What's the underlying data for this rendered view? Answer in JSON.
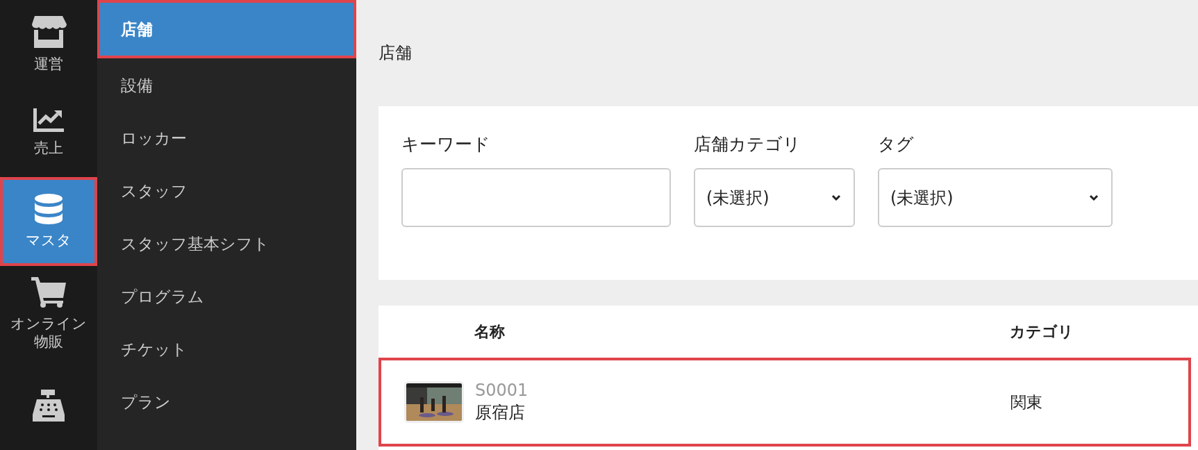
{
  "rail": [
    {
      "label": "運営",
      "selected": false,
      "highlighted": false
    },
    {
      "label": "売上",
      "selected": false,
      "highlighted": false
    },
    {
      "label": "マスタ",
      "selected": true,
      "highlighted": true
    },
    {
      "label": "オンライン物販",
      "selected": false,
      "highlighted": false
    },
    {
      "selected": false,
      "highlighted": false
    }
  ],
  "sidebar": {
    "items": [
      {
        "label": "店舗",
        "selected": true,
        "highlighted": true
      },
      {
        "label": "設備",
        "selected": false,
        "highlighted": false
      },
      {
        "label": "ロッカー",
        "selected": false,
        "highlighted": false
      },
      {
        "label": "スタッフ",
        "selected": false,
        "highlighted": false
      },
      {
        "label": "スタッフ基本シフト",
        "selected": false,
        "highlighted": false
      },
      {
        "label": "プログラム",
        "selected": false,
        "highlighted": false
      },
      {
        "label": "チケット",
        "selected": false,
        "highlighted": false
      },
      {
        "label": "プラン",
        "selected": false,
        "highlighted": false
      }
    ]
  },
  "page": {
    "title": "店舗"
  },
  "filters": [
    {
      "kind": "text",
      "label": "キーワード"
    },
    {
      "kind": "select",
      "label": "店舗カテゴリ",
      "value": "(未選択)"
    },
    {
      "kind": "select",
      "label": "タグ",
      "value": "(未選択)"
    }
  ],
  "table": {
    "columns": [
      "名称",
      "カテゴリ"
    ],
    "rows": [
      {
        "code": "S0001",
        "name": "原宿店",
        "category": "関東",
        "highlighted": true
      }
    ]
  }
}
